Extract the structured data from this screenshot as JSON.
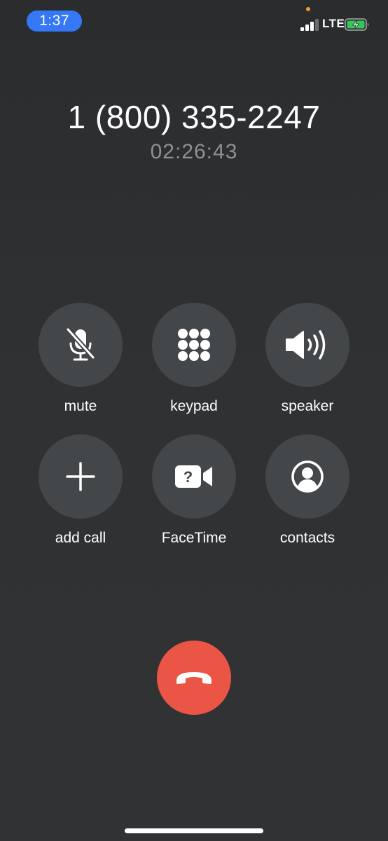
{
  "status_bar": {
    "time": "1:37",
    "network": "LTE",
    "signal_bars_active": 3,
    "signal_bars_total": 4,
    "battery_charging": true,
    "battery_color": "#34c759",
    "time_pill_color": "#3478f6",
    "indicator_dot_color": "#f09a37"
  },
  "call": {
    "number": "1 (800) 335-2247",
    "duration": "02:26:43"
  },
  "controls": [
    {
      "id": "mute",
      "label": "mute",
      "icon": "mic-slash-icon"
    },
    {
      "id": "keypad",
      "label": "keypad",
      "icon": "keypad-grid-icon"
    },
    {
      "id": "speaker",
      "label": "speaker",
      "icon": "speaker-wave-icon"
    },
    {
      "id": "add-call",
      "label": "add call",
      "icon": "plus-icon"
    },
    {
      "id": "facetime",
      "label": "FaceTime",
      "icon": "video-question-icon"
    },
    {
      "id": "contacts",
      "label": "contacts",
      "icon": "person-circle-icon"
    }
  ],
  "end_call": {
    "icon": "phone-down-icon",
    "color": "#eb5545"
  }
}
